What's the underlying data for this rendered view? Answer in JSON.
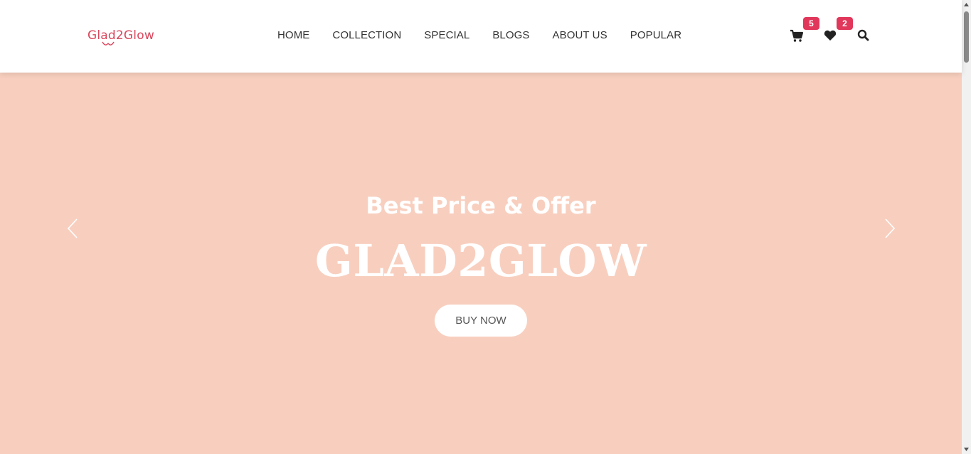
{
  "header": {
    "logo": "Glad2Glow",
    "nav": [
      "HOME",
      "COLLECTION",
      "SPECIAL",
      "BLOGS",
      "ABOUT US",
      "POPULAR"
    ],
    "cart_count": "5",
    "wishlist_count": "2",
    "icons": [
      "cart-icon",
      "heart-icon",
      "search-icon"
    ]
  },
  "hero": {
    "subtitle": "Best Price & Offer",
    "title": "GLAD2GLOW",
    "button": "BUY NOW",
    "background": "#f8cfbf"
  },
  "colors": {
    "brand": "#d9475d",
    "badge": "#e1375a"
  }
}
